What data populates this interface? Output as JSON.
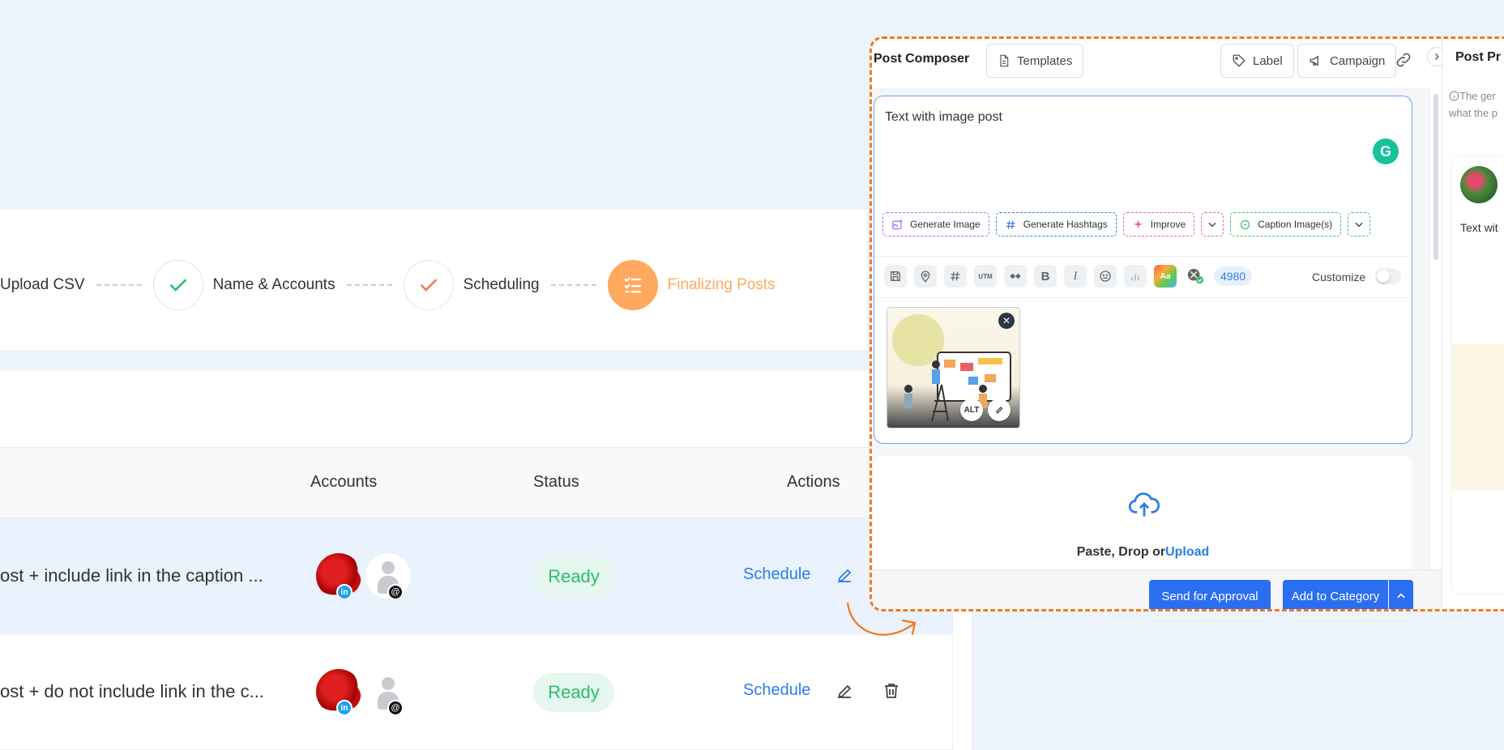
{
  "stepper": {
    "steps": [
      {
        "label": "Upload CSV",
        "state": "done"
      },
      {
        "label": "Name & Accounts",
        "state": "done"
      },
      {
        "label": "Scheduling",
        "state": "done"
      },
      {
        "label": "Finalizing Posts",
        "state": "active"
      }
    ]
  },
  "table": {
    "headers": {
      "accounts": "Accounts",
      "status": "Status",
      "actions": "Actions"
    },
    "rows": [
      {
        "text": "ost + include link in the caption ...",
        "status": "Ready",
        "action": "Schedule"
      },
      {
        "text": "ost + do not include link in the c...",
        "status": "Ready",
        "action": "Schedule"
      }
    ],
    "badge_linkedin": "in",
    "badge_threads": "@"
  },
  "composer": {
    "title": "Post Composer",
    "templates_label": "Templates",
    "label_label": "Label",
    "campaign_label": "Campaign",
    "editor_text": "Text with image post",
    "ai_buttons": {
      "generate_image": "Generate Image",
      "generate_hashtags": "Generate Hashtags",
      "improve": "Improve",
      "caption_images": "Caption Image(s)"
    },
    "tools": {
      "utm": "UTM",
      "bold": "B",
      "italic": "I",
      "font": "Aa"
    },
    "char_count": "4980",
    "customize_label": "Customize",
    "alt_label": "ALT",
    "upload_text": "Paste, Drop or",
    "upload_link": "Upload",
    "send_approval_label": "Send for Approval",
    "add_category_label": "Add to Category"
  },
  "preview": {
    "title": "Post Pr",
    "info_line1": "The ger",
    "info_line2": "what the p",
    "card_text": "Text wit"
  },
  "colors": {
    "accent": "#2b7de9",
    "active_step": "#ffa95e",
    "ready": "#2bbd6e",
    "composer_border": "#f07a22",
    "done_check": "#2bbd6e",
    "scheduling_check": "#f07a5a"
  }
}
